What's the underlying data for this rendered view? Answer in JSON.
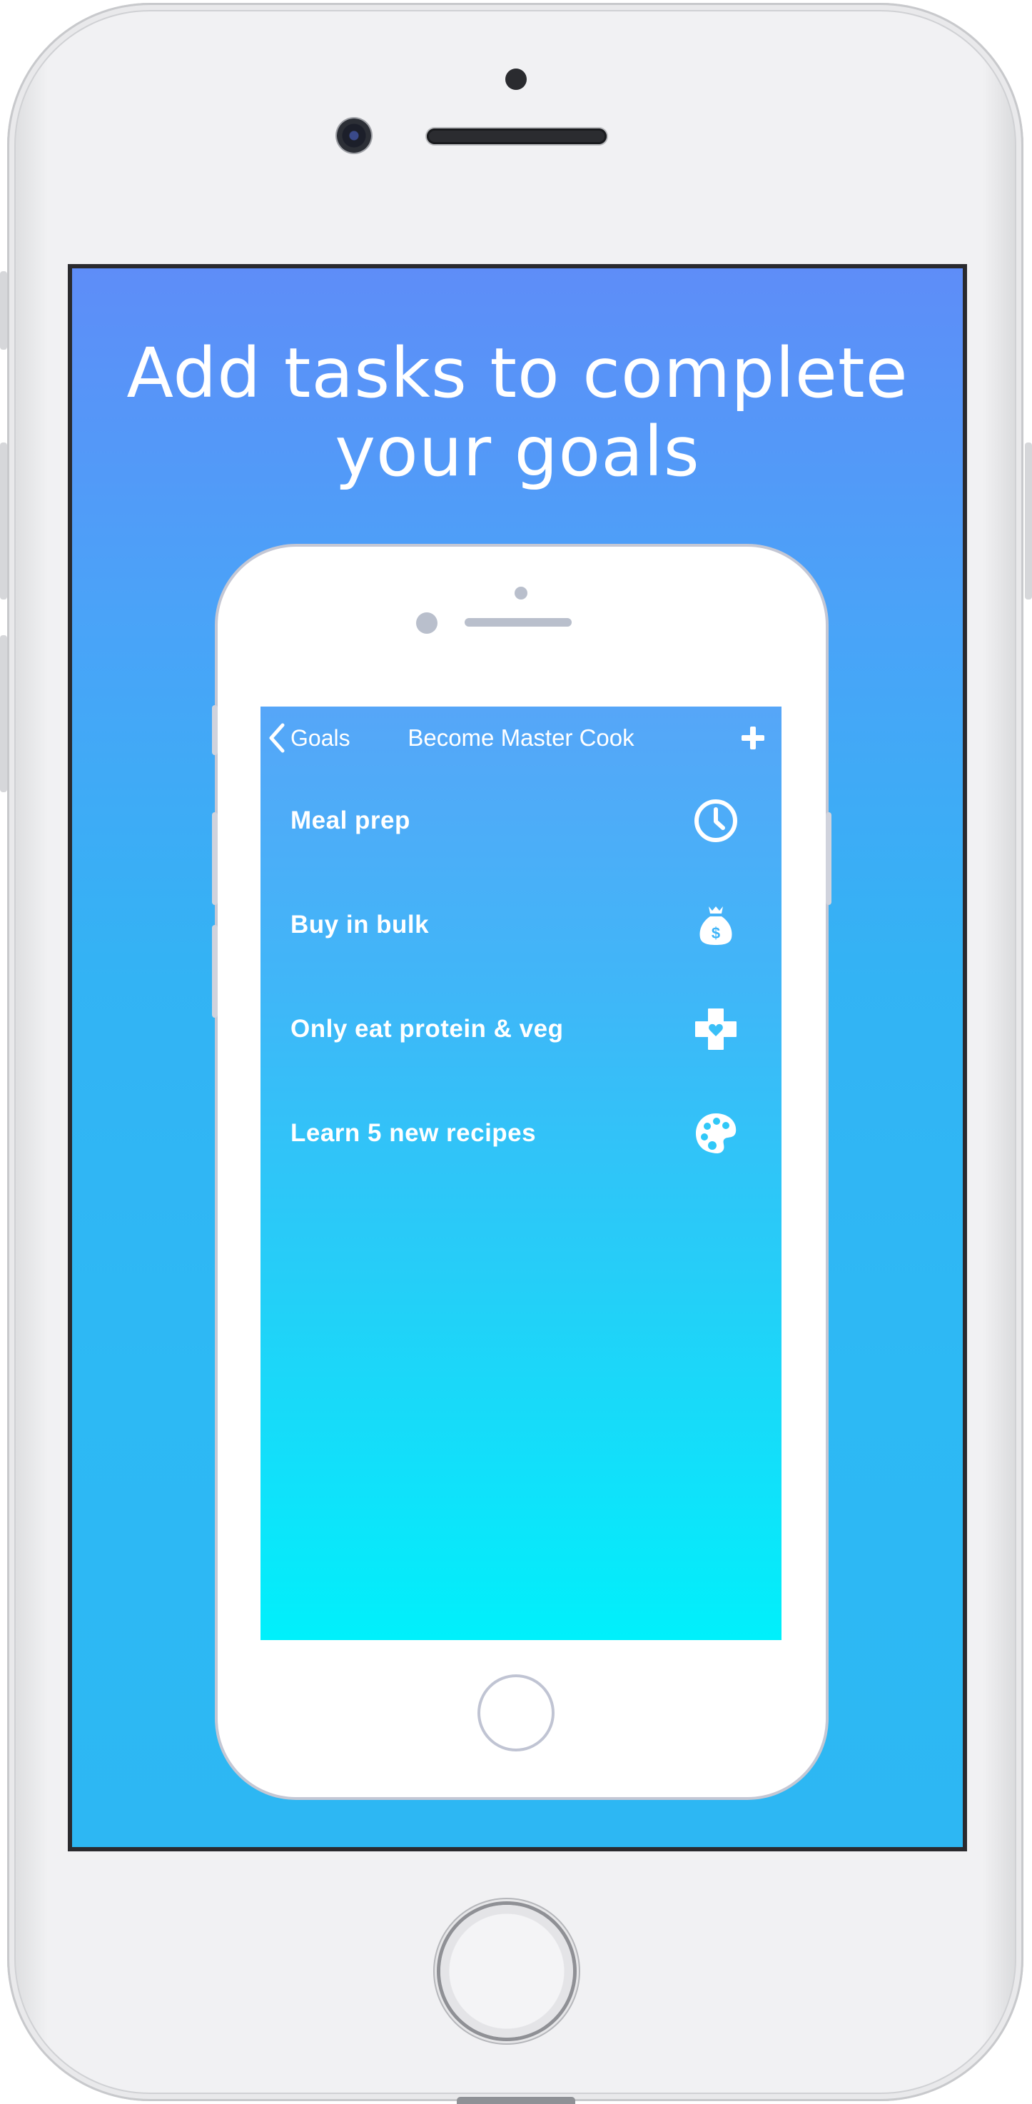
{
  "marketing": {
    "headline": "Add tasks to complete\nyour goals"
  },
  "nav": {
    "back_label": "Goals",
    "title": "Become Master Cook",
    "back_icon": "chevron-left-icon",
    "add_icon": "plus-icon"
  },
  "tasks": [
    {
      "label": "Meal prep",
      "icon": "clock-icon"
    },
    {
      "label": "Buy in bulk",
      "icon": "money-bag-icon"
    },
    {
      "label": "Only eat protein & veg",
      "icon": "health-cross-icon"
    },
    {
      "label": "Learn 5 new recipes",
      "icon": "palette-icon"
    }
  ],
  "colors": {
    "outer_gradient_top": "#5e8df8",
    "outer_gradient_bottom": "#2db7f3",
    "inner_gradient_top": "#56a6f8",
    "inner_gradient_bottom": "#00f0fb",
    "text": "#ffffff"
  }
}
